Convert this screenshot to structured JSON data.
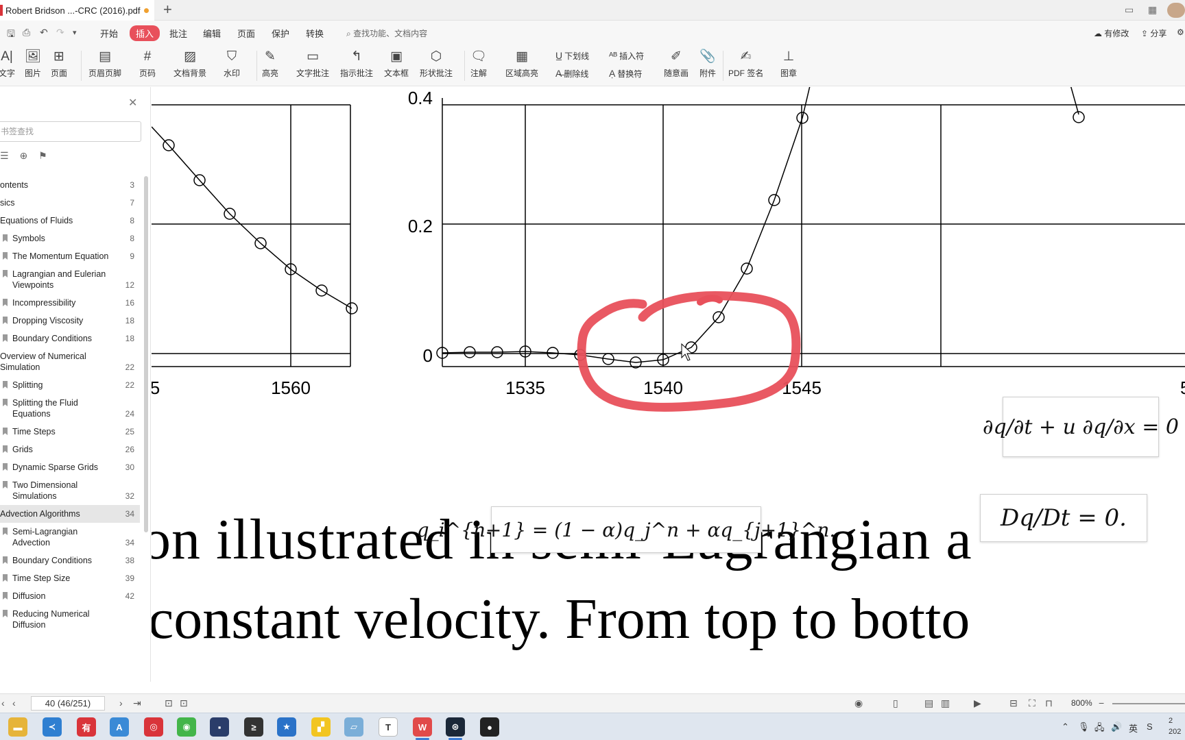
{
  "titlebar": {
    "doc_tab": "Robert Bridson ...-CRC (2016).pdf",
    "new_tab": "+"
  },
  "menubar": {
    "items": [
      "开始",
      "插入",
      "批注",
      "编辑",
      "页面",
      "保护",
      "转换"
    ],
    "active": "插入",
    "search_placeholder": "查找功能、文档内容",
    "right": [
      "有修改",
      "分享"
    ]
  },
  "ribbon": {
    "tools": [
      {
        "icon": "text-icon",
        "label": "文字"
      },
      {
        "icon": "image-icon",
        "label": "图片"
      },
      {
        "icon": "page-add-icon",
        "label": "页面"
      },
      {
        "icon": "header-footer-icon",
        "label": "页眉页脚"
      },
      {
        "icon": "page-number-icon",
        "label": "页码"
      },
      {
        "icon": "background-icon",
        "label": "文档背景"
      },
      {
        "icon": "watermark-icon",
        "label": "水印"
      },
      {
        "icon": "highlight-icon",
        "label": "高亮"
      },
      {
        "icon": "text-comment-icon",
        "label": "文字批注"
      },
      {
        "icon": "pointer-comment-icon",
        "label": "指示批注"
      },
      {
        "icon": "textbox-icon",
        "label": "文本框"
      },
      {
        "icon": "shape-comment-icon",
        "label": "形状批注"
      },
      {
        "icon": "annotation-icon",
        "label": "注解"
      },
      {
        "icon": "area-highlight-icon",
        "label": "区域高亮"
      },
      {
        "icon": "underline-icon",
        "label": "下划线"
      },
      {
        "icon": "strikethrough-icon",
        "label": "删除线"
      },
      {
        "icon": "insert-mark-icon",
        "label": "插入符"
      },
      {
        "icon": "replace-mark-icon",
        "label": "替换符"
      },
      {
        "icon": "freehand-icon",
        "label": "随意画"
      },
      {
        "icon": "attachment-icon",
        "label": "附件"
      },
      {
        "icon": "pdf-sign-icon",
        "label": "PDF 签名"
      },
      {
        "icon": "stamp-icon",
        "label": "图章"
      }
    ]
  },
  "sidebar": {
    "search_placeholder": "书签查找",
    "items": [
      {
        "label": "ontents",
        "page": "3",
        "level": 1
      },
      {
        "label": "sics",
        "page": "7",
        "level": 1
      },
      {
        "label": "Equations of Fluids",
        "page": "8",
        "level": 1
      },
      {
        "label": "Symbols",
        "page": "8",
        "level": 2
      },
      {
        "label": "The Momentum Equation",
        "page": "9",
        "level": 2
      },
      {
        "label": "Lagrangian and Eulerian Viewpoints",
        "page": "12",
        "level": 2
      },
      {
        "label": "Incompressibility",
        "page": "16",
        "level": 2
      },
      {
        "label": "Dropping Viscosity",
        "page": "18",
        "level": 2
      },
      {
        "label": "Boundary Conditions",
        "page": "18",
        "level": 2
      },
      {
        "label": "Overview of Numerical Simulation",
        "page": "22",
        "level": 1
      },
      {
        "label": "Splitting",
        "page": "22",
        "level": 2
      },
      {
        "label": "Splitting the Fluid Equations",
        "page": "24",
        "level": 2
      },
      {
        "label": "Time Steps",
        "page": "25",
        "level": 2
      },
      {
        "label": "Grids",
        "page": "26",
        "level": 2
      },
      {
        "label": "Dynamic Sparse Grids",
        "page": "30",
        "level": 2
      },
      {
        "label": "Two Dimensional Simulations",
        "page": "32",
        "level": 2
      },
      {
        "label": "Advection Algorithms",
        "page": "34",
        "level": 1,
        "selected": true
      },
      {
        "label": "Semi-Lagrangian Advection",
        "page": "34",
        "level": 2
      },
      {
        "label": "Boundary Conditions",
        "page": "38",
        "level": 2
      },
      {
        "label": "Time Step Size",
        "page": "39",
        "level": 2
      },
      {
        "label": "Diffusion",
        "page": "42",
        "level": 2
      },
      {
        "label": "Reducing Numerical Diffusion",
        "page": "",
        "level": 2
      }
    ]
  },
  "document": {
    "left_plot_ticks": [
      "5",
      "1560"
    ],
    "right_plot_yticks": [
      "0.4",
      "0.2",
      "0"
    ],
    "right_plot_xticks": [
      "1535",
      "1540",
      "1545",
      "5"
    ],
    "eq_advection": "∂q/∂t + u ∂q/∂x = 0",
    "eq_material": "Dq/Dt = 0.",
    "eq_update": "q_i^{n+1} = (1 − α)q_j^n + αq_{j+1}^n.",
    "text_line1": "on  illustrated  in  semi-Lagrangian  a",
    "text_line2": "constant velocity.  From top to botto"
  },
  "statusbar": {
    "page_indicator": "40 (46/251)",
    "zoom": "800%"
  },
  "taskbar": {
    "tray_lang": "英",
    "clock_time": "2",
    "clock_date": "202"
  },
  "colors": {
    "accent": "#e8505b",
    "annotation": "#e8505b"
  }
}
